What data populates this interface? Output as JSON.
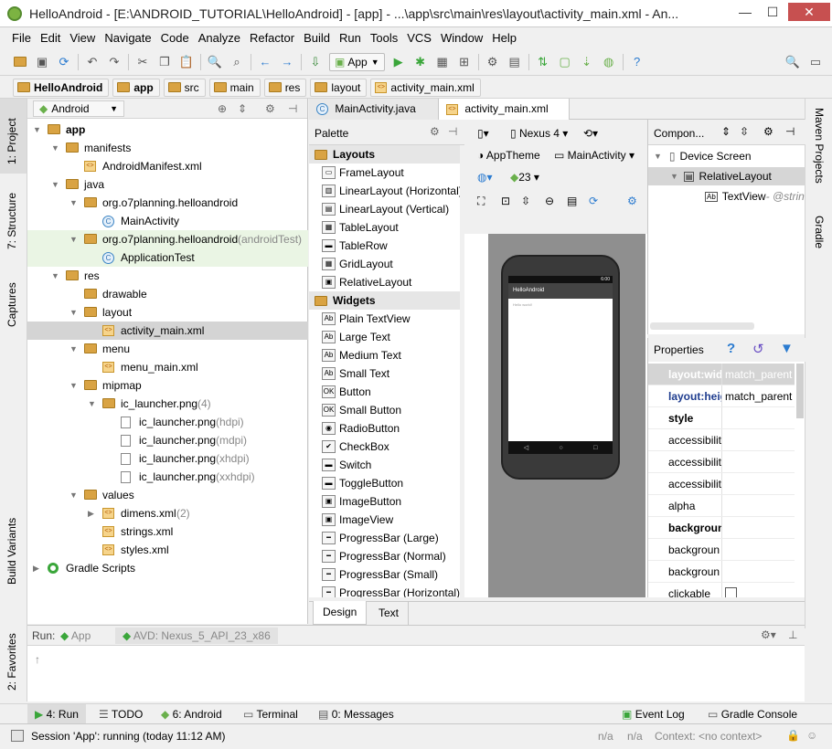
{
  "window": {
    "title": "HelloAndroid - [E:\\ANDROID_TUTORIAL\\HelloAndroid] - [app] - ...\\app\\src\\main\\res\\layout\\activity_main.xml - An...",
    "minimize": "—",
    "maximize": "☐",
    "close": "✕"
  },
  "menu": [
    "File",
    "Edit",
    "View",
    "Navigate",
    "Code",
    "Analyze",
    "Refactor",
    "Build",
    "Run",
    "Tools",
    "VCS",
    "Window",
    "Help"
  ],
  "toolbar": {
    "run_config": "App"
  },
  "breadcrumb": [
    "HelloAndroid",
    "app",
    "src",
    "main",
    "res",
    "layout",
    "activity_main.xml"
  ],
  "left_strip": [
    "1: Project",
    "7: Structure",
    "Captures",
    "Build Variants",
    "2: Favorites"
  ],
  "right_strip": [
    "Maven Projects",
    "Gradle"
  ],
  "project": {
    "view": "Android",
    "tree": [
      {
        "label": "app",
        "extra": "",
        "bold": true
      },
      {
        "label": "manifests",
        "extra": ""
      },
      {
        "label": "AndroidManifest.xml",
        "extra": ""
      },
      {
        "label": "java",
        "extra": ""
      },
      {
        "label": "org.o7planning.helloandroid",
        "extra": ""
      },
      {
        "label": "MainActivity",
        "extra": ""
      },
      {
        "label": "org.o7planning.helloandroid",
        "extra": " (androidTest)"
      },
      {
        "label": "ApplicationTest",
        "extra": ""
      },
      {
        "label": "res",
        "extra": ""
      },
      {
        "label": "drawable",
        "extra": ""
      },
      {
        "label": "layout",
        "extra": ""
      },
      {
        "label": "activity_main.xml",
        "extra": ""
      },
      {
        "label": "menu",
        "extra": ""
      },
      {
        "label": "menu_main.xml",
        "extra": ""
      },
      {
        "label": "mipmap",
        "extra": ""
      },
      {
        "label": "ic_launcher.png",
        "extra": " (4)"
      },
      {
        "label": "ic_launcher.png",
        "extra": " (hdpi)"
      },
      {
        "label": "ic_launcher.png",
        "extra": " (mdpi)"
      },
      {
        "label": "ic_launcher.png",
        "extra": " (xhdpi)"
      },
      {
        "label": "ic_launcher.png",
        "extra": " (xxhdpi)"
      },
      {
        "label": "values",
        "extra": ""
      },
      {
        "label": "dimens.xml",
        "extra": " (2)"
      },
      {
        "label": "strings.xml",
        "extra": ""
      },
      {
        "label": "styles.xml",
        "extra": ""
      },
      {
        "label": "Gradle Scripts",
        "extra": ""
      }
    ]
  },
  "editor_tabs": [
    "MainActivity.java",
    "activity_main.xml"
  ],
  "palette": {
    "title": "Palette",
    "items": [
      {
        "label": "Layouts",
        "group": true
      },
      {
        "label": "FrameLayout"
      },
      {
        "label": "LinearLayout (Horizontal)"
      },
      {
        "label": "LinearLayout (Vertical)"
      },
      {
        "label": "TableLayout"
      },
      {
        "label": "TableRow"
      },
      {
        "label": "GridLayout"
      },
      {
        "label": "RelativeLayout"
      },
      {
        "label": "Widgets",
        "group": true
      },
      {
        "label": "Plain TextView"
      },
      {
        "label": "Large Text"
      },
      {
        "label": "Medium Text"
      },
      {
        "label": "Small Text"
      },
      {
        "label": "Button"
      },
      {
        "label": "Small Button"
      },
      {
        "label": "RadioButton"
      },
      {
        "label": "CheckBox"
      },
      {
        "label": "Switch"
      },
      {
        "label": "ToggleButton"
      },
      {
        "label": "ImageButton"
      },
      {
        "label": "ImageView"
      },
      {
        "label": "ProgressBar (Large)"
      },
      {
        "label": "ProgressBar (Normal)"
      },
      {
        "label": "ProgressBar (Small)"
      },
      {
        "label": "ProgressBar (Horizontal)"
      }
    ]
  },
  "designer": {
    "device": "Nexus 4",
    "theme": "AppTheme",
    "activity": "MainActivity",
    "api": "23",
    "app_name": "HelloAndroid",
    "hello": "Hello world!",
    "time": "6:00"
  },
  "component_tree": {
    "title": "Compon...",
    "items": [
      "Device Screen",
      "RelativeLayout",
      "TextView"
    ],
    "textview_extra": " - @strin"
  },
  "properties": {
    "title": "Properties",
    "rows": [
      {
        "name": "layout:wid",
        "value": "match_parent"
      },
      {
        "name": "layout:heig",
        "value": "match_parent"
      },
      {
        "name": "style",
        "value": ""
      },
      {
        "name": "accessibilit",
        "value": ""
      },
      {
        "name": "accessibilit",
        "value": ""
      },
      {
        "name": "accessibilit",
        "value": ""
      },
      {
        "name": "alpha",
        "value": ""
      },
      {
        "name": "backgroun",
        "value": ""
      },
      {
        "name": "backgroun",
        "value": ""
      },
      {
        "name": "backgroun",
        "value": ""
      },
      {
        "name": "clickable",
        "value": ""
      }
    ]
  },
  "design_tabs": [
    "Design",
    "Text"
  ],
  "run": {
    "label": "Run:",
    "tabs": [
      "App",
      "AVD: Nexus_5_API_23_x86"
    ]
  },
  "bottom_tabs": [
    "4: Run",
    "TODO",
    "6: Android",
    "Terminal",
    "0: Messages",
    "Event Log",
    "Gradle Console"
  ],
  "status": {
    "text": "Session 'App': running (today 11:12 AM)",
    "na1": "n/a",
    "na2": "n/a",
    "context": "Context: <no context>"
  }
}
